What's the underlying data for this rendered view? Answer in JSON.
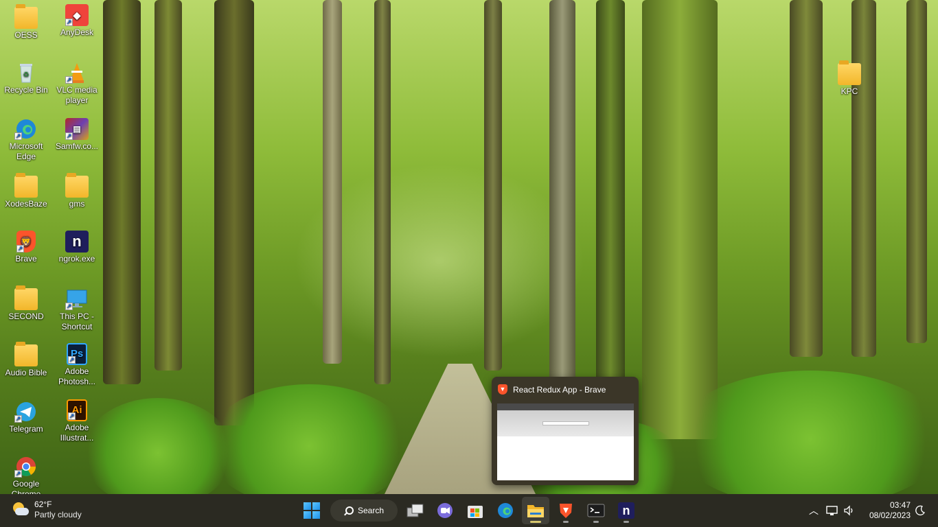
{
  "desktop": {
    "icons": [
      {
        "label": "OESS"
      },
      {
        "label": "AnyDesk"
      },
      {
        "label": "Recycle Bin"
      },
      {
        "label": "VLC media player"
      },
      {
        "label": "Microsoft Edge"
      },
      {
        "label": "Samfw.co..."
      },
      {
        "label": "XodesBaze"
      },
      {
        "label": "gms"
      },
      {
        "label": "Brave"
      },
      {
        "label": "ngrok.exe"
      },
      {
        "label": "SECOND"
      },
      {
        "label": "This PC - Shortcut"
      },
      {
        "label": "Audio Bible"
      },
      {
        "label": "Adobe Photosh..."
      },
      {
        "label": "Telegram"
      },
      {
        "label": "Adobe Illustrat..."
      },
      {
        "label": "Google Chrome"
      },
      {
        "label": "KPC"
      }
    ]
  },
  "thumbnail": {
    "title": "React Redux App - Brave"
  },
  "taskbar": {
    "weather": {
      "temperature": "62°F",
      "condition": "Partly cloudy"
    },
    "search_label": "Search",
    "apps": [
      "start-icon",
      "task-view-icon",
      "teams-chat-icon",
      "microsoft-store-icon",
      "edge-icon",
      "file-explorer-icon",
      "brave-icon",
      "terminal-icon",
      "ngrok-icon"
    ],
    "clock": {
      "time": "03:47",
      "date": "08/02/2023"
    }
  },
  "colors": {
    "taskbar_bg": "#2b2a22",
    "folder": "#f2b62a",
    "brave": "#fb542b",
    "ngrok": "#1f1e5c",
    "accent": "#1b8fe8"
  }
}
